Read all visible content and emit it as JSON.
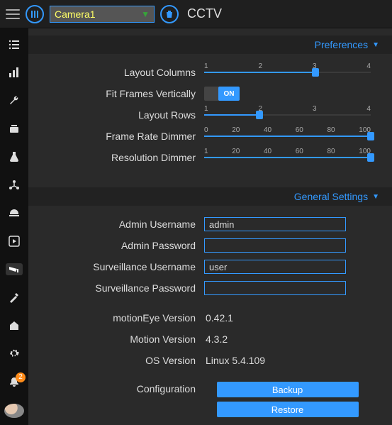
{
  "header": {
    "camera_name": "Camera1",
    "app_title": "CCTV"
  },
  "notifications": {
    "count": "2"
  },
  "preferences": {
    "title": "Preferences",
    "layout_columns": {
      "label": "Layout Columns",
      "ticks": [
        "1",
        "2",
        "3",
        "4"
      ],
      "value": 3,
      "min": 1,
      "max": 4
    },
    "fit_frames": {
      "label": "Fit Frames Vertically",
      "on_text": "ON",
      "value": true
    },
    "layout_rows": {
      "label": "Layout Rows",
      "ticks": [
        "1",
        "2",
        "3",
        "4"
      ],
      "value": 2,
      "min": 1,
      "max": 4
    },
    "frame_rate": {
      "label": "Frame Rate Dimmer",
      "ticks": [
        "0",
        "20",
        "40",
        "60",
        "80",
        "100"
      ],
      "value": 100,
      "min": 0,
      "max": 100
    },
    "resolution": {
      "label": "Resolution Dimmer",
      "ticks": [
        "1",
        "20",
        "40",
        "60",
        "80",
        "100"
      ],
      "value": 100,
      "min": 1,
      "max": 100
    }
  },
  "general": {
    "title": "General Settings",
    "admin_user": {
      "label": "Admin Username",
      "value": "admin"
    },
    "admin_pass": {
      "label": "Admin Password",
      "value": ""
    },
    "surv_user": {
      "label": "Surveillance Username",
      "value": "user"
    },
    "surv_pass": {
      "label": "Surveillance Password",
      "value": ""
    },
    "me_version": {
      "label": "motionEye Version",
      "value": "0.42.1"
    },
    "m_version": {
      "label": "Motion Version",
      "value": "4.3.2"
    },
    "os_version": {
      "label": "OS Version",
      "value": "Linux 5.4.109"
    },
    "config_label": "Configuration",
    "backup_btn": "Backup",
    "restore_btn": "Restore"
  }
}
